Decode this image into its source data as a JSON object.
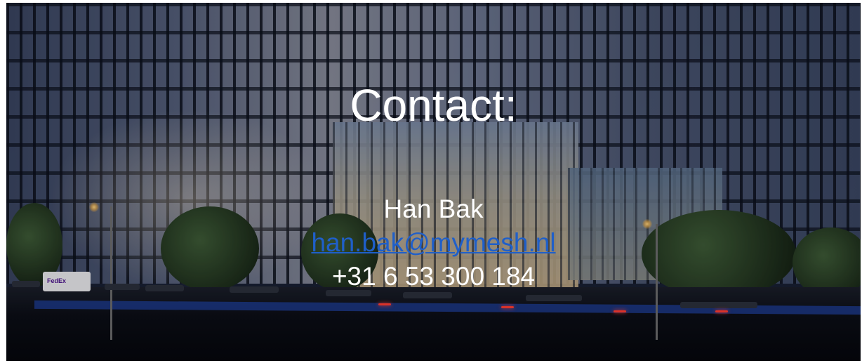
{
  "slide": {
    "title": "Contact:",
    "contact_name": "Han Bak",
    "email": "han.bak@mymesh.nl",
    "phone": "+31 6 53 300 184",
    "van_logo": "FedEx"
  },
  "colors": {
    "text": "#ffffff",
    "link": "#1f5fc9",
    "road_stripe": "#1d3a8a"
  }
}
